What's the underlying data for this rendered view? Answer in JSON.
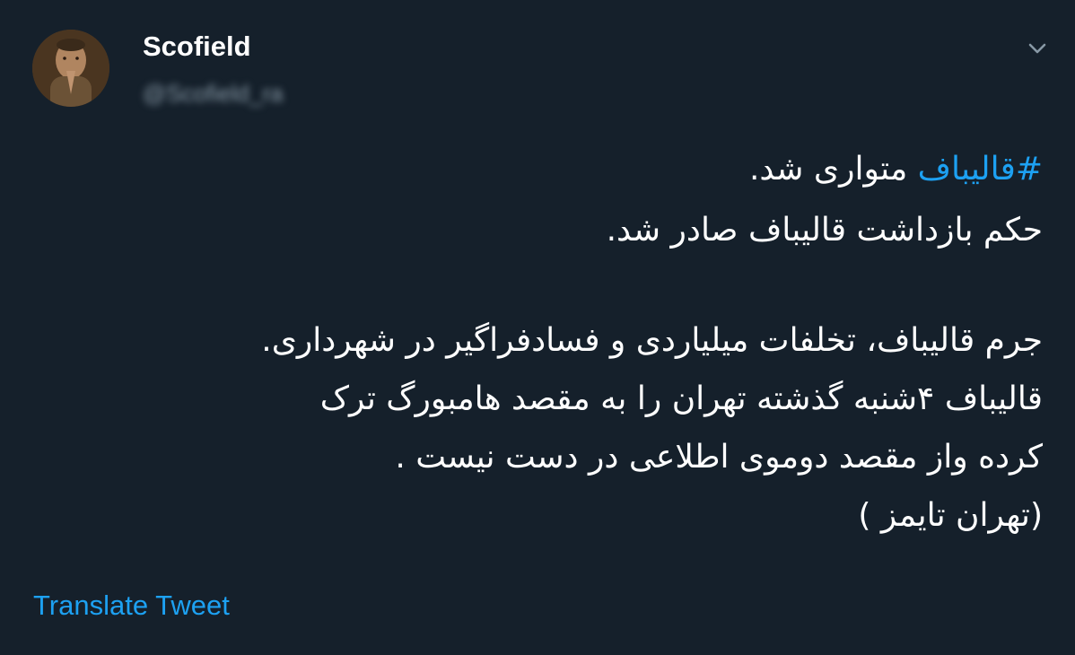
{
  "tweet": {
    "author": {
      "display_name": "Scofield",
      "handle": "@Scofield_ra",
      "avatar_icon": "person-profile-avatar"
    },
    "menu_icon": "chevron-down-icon",
    "hashtag": "#قالیباف",
    "line1_rest": " متواری شد.",
    "line2": "حکم بازداشت قالیباف صادر شد.",
    "line3": "جرم قالیباف، تخلفات میلیاردی و فسادفراگیر در شهرداری.",
    "line4": "قالیباف ۴شنبه گذشته تهران را به مقصد هامبورگ ترک",
    "line5": "کرده واز مقصد دوموی اطلاعی در دست نیست .",
    "line6": "(تهران تایمز )",
    "translate_label": "Translate Tweet"
  },
  "colors": {
    "background": "#15202b",
    "text": "#ffffff",
    "accent": "#1da1f2",
    "secondary": "#8899a6"
  }
}
